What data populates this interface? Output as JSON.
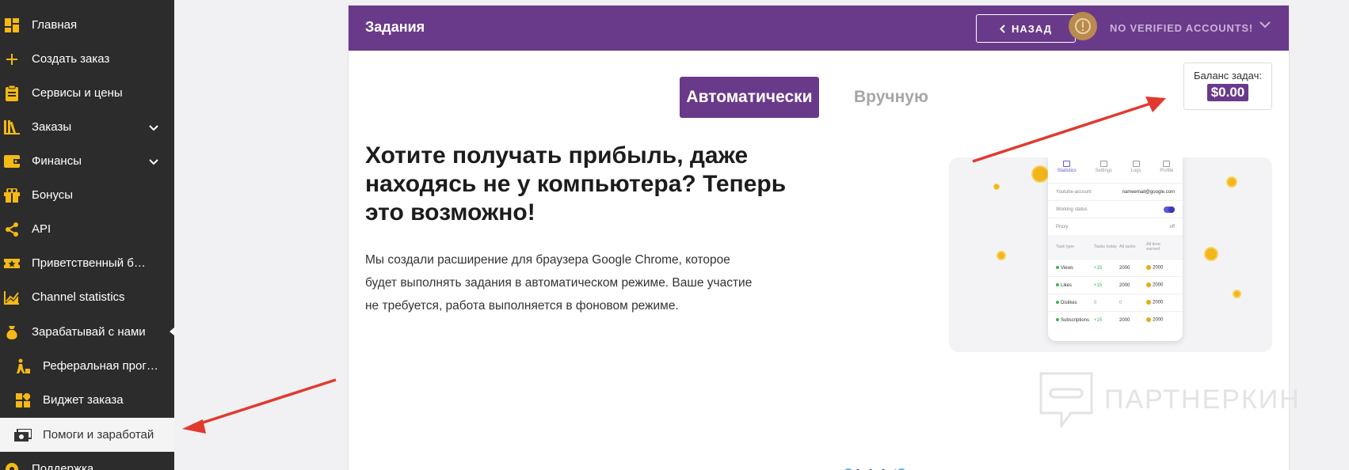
{
  "sidebar": {
    "items": [
      {
        "label": "Главная",
        "icon": "dashboard-icon"
      },
      {
        "label": "Создать заказ",
        "icon": "plus-icon"
      },
      {
        "label": "Сервисы и цены",
        "icon": "clipboard-icon"
      },
      {
        "label": "Заказы",
        "icon": "books-icon"
      },
      {
        "label": "Финансы",
        "icon": "wallet-icon"
      },
      {
        "label": "Бонусы",
        "icon": "gift-icon"
      },
      {
        "label": "API",
        "icon": "share-icon"
      },
      {
        "label": "Приветственный бонус",
        "icon": "ticket-icon"
      },
      {
        "label": "Channel statistics",
        "icon": "chart-icon"
      },
      {
        "label": "Зарабатывай с нами",
        "icon": "moneybag-icon"
      },
      {
        "label": "Реферальная программа",
        "icon": "referral-icon"
      },
      {
        "label": "Виджет заказа",
        "icon": "widget-icon"
      },
      {
        "label": "Помоги и заработай",
        "icon": "cash-icon"
      },
      {
        "label": "Поддержка",
        "icon": "support-icon"
      }
    ]
  },
  "header": {
    "title": "Задания",
    "back_label": "НАЗАД",
    "account_status": "NO VERIFIED ACCOUNTS!"
  },
  "tabs": {
    "auto": "Автоматически",
    "manual": "Вручную"
  },
  "balance": {
    "label": "Баланс задач:",
    "value": "$0.00"
  },
  "content": {
    "headline": "Хотите получать прибыль, даже находясь не у компьютера? Теперь это возможно!",
    "description": "Мы создали расширение для браузера Google Chrome, которое будет выполнять задания в автоматическом режиме. Ваше участие не требуется, работа выполняется в фоновом режиме."
  },
  "preview": {
    "tabs": [
      "Statistics",
      "Settings",
      "Logs",
      "Profile"
    ],
    "youtube_label": "Youtube-account",
    "youtube_value": "nameemail@google.com",
    "working_label": "Working status",
    "proxy_label": "Proxy",
    "proxy_value": "off",
    "table_headers": [
      "Task type",
      "Tasks today",
      "All tasks",
      "All time earned"
    ],
    "rows": [
      {
        "type": "Views",
        "today": "+15",
        "all": "2000",
        "earned": "2000"
      },
      {
        "type": "Likes",
        "today": "+15",
        "all": "2000",
        "earned": "2000"
      },
      {
        "type": "Dislikes",
        "today": "0",
        "all": "0",
        "earned": "2000"
      },
      {
        "type": "Subscriptions",
        "today": "+15",
        "all": "2000",
        "earned": "2000"
      }
    ]
  },
  "watermark": "ПАРТНЕРКИН",
  "colors": {
    "sidebar_bg": "#2c2c2c",
    "accent_purple": "#6a3a8a",
    "icon_yellow": "#f5b915",
    "arrow_red": "#e03a2f"
  }
}
